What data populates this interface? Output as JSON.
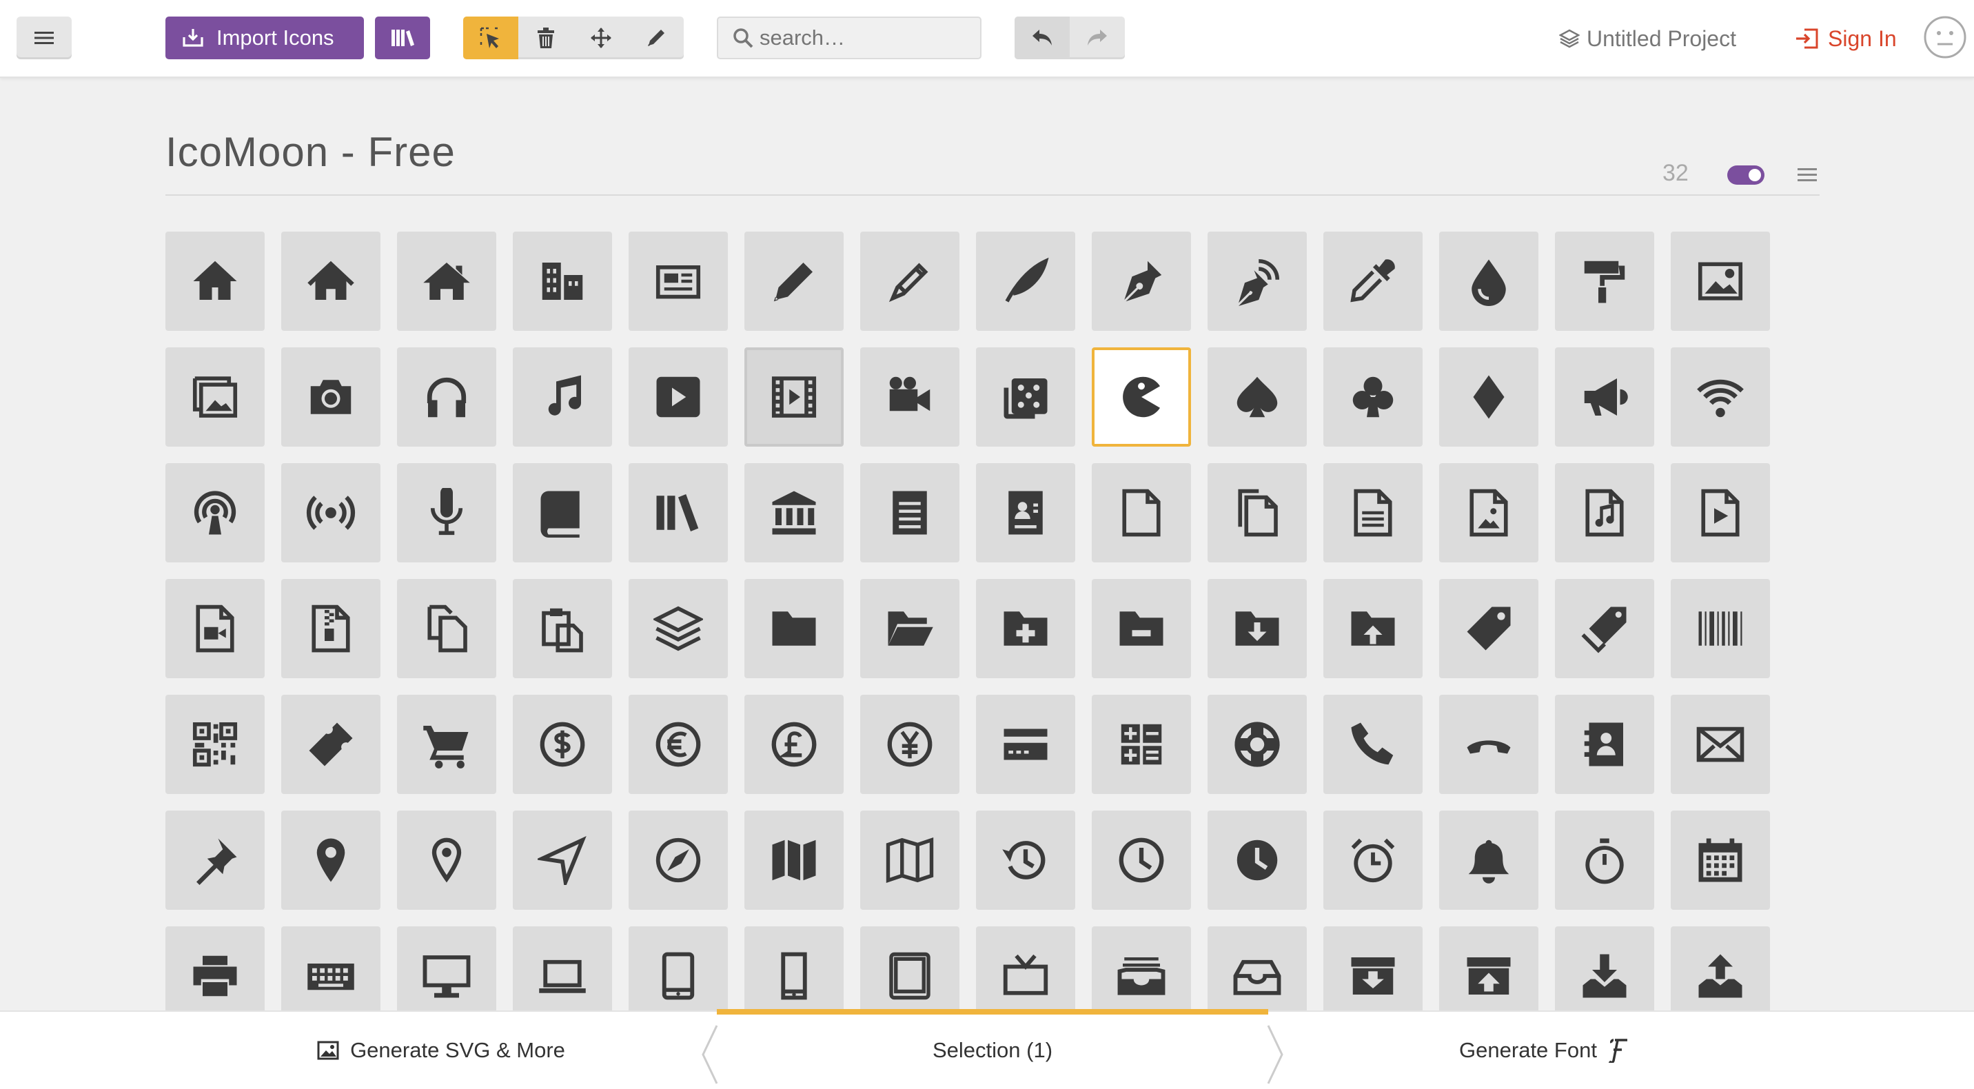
{
  "header": {
    "import_label": "Import Icons",
    "search_placeholder": "search…",
    "project_label": "Untitled Project",
    "signin_label": "Sign In"
  },
  "icon_set": {
    "title": "IcoMoon - Free",
    "count": "32",
    "show_names_toggle": true
  },
  "icons": [
    [
      "home",
      "home2",
      "home3",
      "office",
      "newspaper",
      "pencil",
      "pencil2",
      "quill",
      "pen",
      "blog",
      "eyedropper",
      "droplet",
      "paint-format",
      "image"
    ],
    [
      "images",
      "camera",
      "headphones",
      "music",
      "play",
      "film",
      "video-camera",
      "dice",
      "pacman",
      "spades",
      "clubs",
      "diamonds",
      "bullhorn",
      "connection"
    ],
    [
      "podcast",
      "feed",
      "mic",
      "book",
      "books",
      "library",
      "file-text",
      "profile",
      "file-empty",
      "files-empty",
      "file-text2",
      "file-picture",
      "file-music",
      "file-play"
    ],
    [
      "file-video",
      "file-zip",
      "copy",
      "paste",
      "stack",
      "folder",
      "folder-open",
      "folder-plus",
      "folder-minus",
      "folder-download",
      "folder-upload",
      "price-tag",
      "price-tags",
      "barcode"
    ],
    [
      "qrcode",
      "ticket",
      "cart",
      "coin-dollar",
      "coin-euro",
      "coin-pound",
      "coin-yen",
      "credit-card",
      "calculator",
      "lifebuoy",
      "phone",
      "phone-hang-up",
      "address-book",
      "envelop"
    ],
    [
      "pushpin",
      "location",
      "location2",
      "compass",
      "compass2",
      "map",
      "map2",
      "history",
      "clock",
      "clock2",
      "alarm",
      "bell",
      "stopwatch",
      "calendar"
    ],
    [
      "printer",
      "keyboard",
      "display",
      "laptop",
      "mobile",
      "mobile2",
      "tablet",
      "tv",
      "drawer",
      "drawer2",
      "box-add",
      "box-remove",
      "download",
      "upload"
    ]
  ],
  "selected_icon": "pacman",
  "hovered_icon": "film",
  "footer": {
    "generate_svg_label": "Generate SVG & More",
    "selection_label": "Selection (1)",
    "generate_font_label": "Generate Font"
  },
  "colors": {
    "accent_purple": "#7b4f9e",
    "accent_orange": "#f0b43c",
    "signin_red": "#d9452b",
    "icon_fill": "#3a3a3a",
    "tile_bg": "#dcdcdc"
  }
}
